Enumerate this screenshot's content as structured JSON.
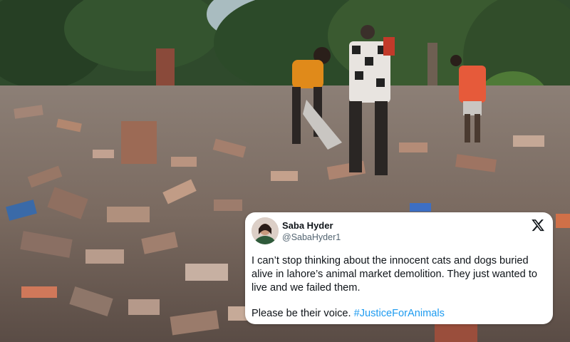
{
  "tweet": {
    "display_name": "Saba Hyder",
    "handle": "@SabaHyder1",
    "text_line1": "I can’t stop thinking about the innocent cats and dogs buried alive in lahore’s animal market demolition. They just wanted to live and we failed them.",
    "text_line2_prefix": "Please be their voice. ",
    "hashtag": "#JusticeForAnimals",
    "hashtag_color": "#1d9bf0",
    "platform_icon": "x-logo-icon"
  },
  "photo": {
    "subject": "rubble-photo",
    "icons": [
      "brick-rubble",
      "trees",
      "chimney",
      "person-orange-shirt",
      "person-checked-shirt",
      "person-red-vest"
    ]
  }
}
